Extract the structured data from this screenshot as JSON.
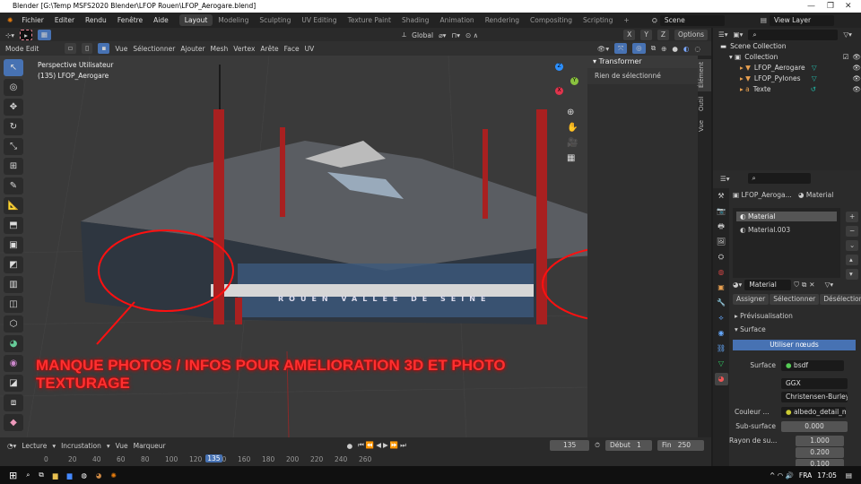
{
  "window": {
    "title": "Blender [G:\\Temp MSFS2020 Blender\\LFOP Rouen\\LFOP_Aerogare.blend]",
    "controls": [
      "—",
      "❐",
      "✕"
    ]
  },
  "menu": [
    "Fichier",
    "Editer",
    "Rendu",
    "Fenêtre",
    "Aide"
  ],
  "workspaces": [
    "Layout",
    "Modeling",
    "Sculpting",
    "UV Editing",
    "Texture Paint",
    "Shading",
    "Animation",
    "Rendering",
    "Compositing",
    "Scripting",
    "+"
  ],
  "scene": "Scene",
  "view_layer": "View Layer",
  "header1": {
    "orientation": "Global",
    "options": "Options",
    "axes": [
      "X",
      "Y",
      "Z"
    ]
  },
  "header2": {
    "mode": "Mode Edit",
    "menus": [
      "Vue",
      "Sélectionner",
      "Ajouter",
      "Mesh",
      "Vertex",
      "Arête",
      "Face",
      "UV"
    ]
  },
  "viewport": {
    "view_name": "Perspective Utilisateur",
    "object": "(135) LFOP_Aerogare",
    "facade_text": "ROUEN VALLEE DE SEINE",
    "annotation": "MANQUE PHOTOS / INFOS POUR AMELIORATION 3D ET PHOTO TEXTURAGE",
    "gizmo": [
      "X",
      "Y",
      "Z"
    ],
    "accent": "#e01010"
  },
  "npanel": {
    "section": "Transformer",
    "message": "Rien de sélectionné",
    "tabs": [
      "Élément",
      "Outil",
      "Vue"
    ]
  },
  "outliner": {
    "root": "Scene Collection",
    "collection": "Collection",
    "items": [
      "LFOP_Aerogare",
      "LFOP_Pylones",
      "Texte"
    ]
  },
  "properties": {
    "object": "LFOP_Aeroga...",
    "slot_type": "Material",
    "slots": [
      "Material",
      "Material.003"
    ],
    "material": "Material",
    "buttons": [
      "Assigner",
      "Sélectionner",
      "Désélection..."
    ],
    "sections": [
      "Prévisualisation",
      "Surface"
    ],
    "use_nodes": "Utiliser nœuds",
    "surface_label": "Surface",
    "surface": "bsdf",
    "distribution": "GGX",
    "subsurface_method": "Christensen-Burley",
    "color_label": "Couleur ...",
    "color": "albedo_detail_mix",
    "subsurface_label": "Sub-surface",
    "subsurface": "0.000",
    "radius_label": "Rayon de su...",
    "radius": [
      "1.000",
      "0.200",
      "0.100"
    ]
  },
  "timeline": {
    "menus": [
      "Lecture",
      "Incrustation",
      "Vue",
      "Marqueur"
    ],
    "frame": "135",
    "start_label": "Début",
    "start": "1",
    "end_label": "Fin",
    "end": "250",
    "ticks": [
      "0",
      "20",
      "40",
      "60",
      "80",
      "100",
      "120",
      "140",
      "160",
      "180",
      "200",
      "220",
      "240",
      "260"
    ],
    "current": "135"
  },
  "taskbar": {
    "lang": "FRA",
    "time": "17:05"
  }
}
